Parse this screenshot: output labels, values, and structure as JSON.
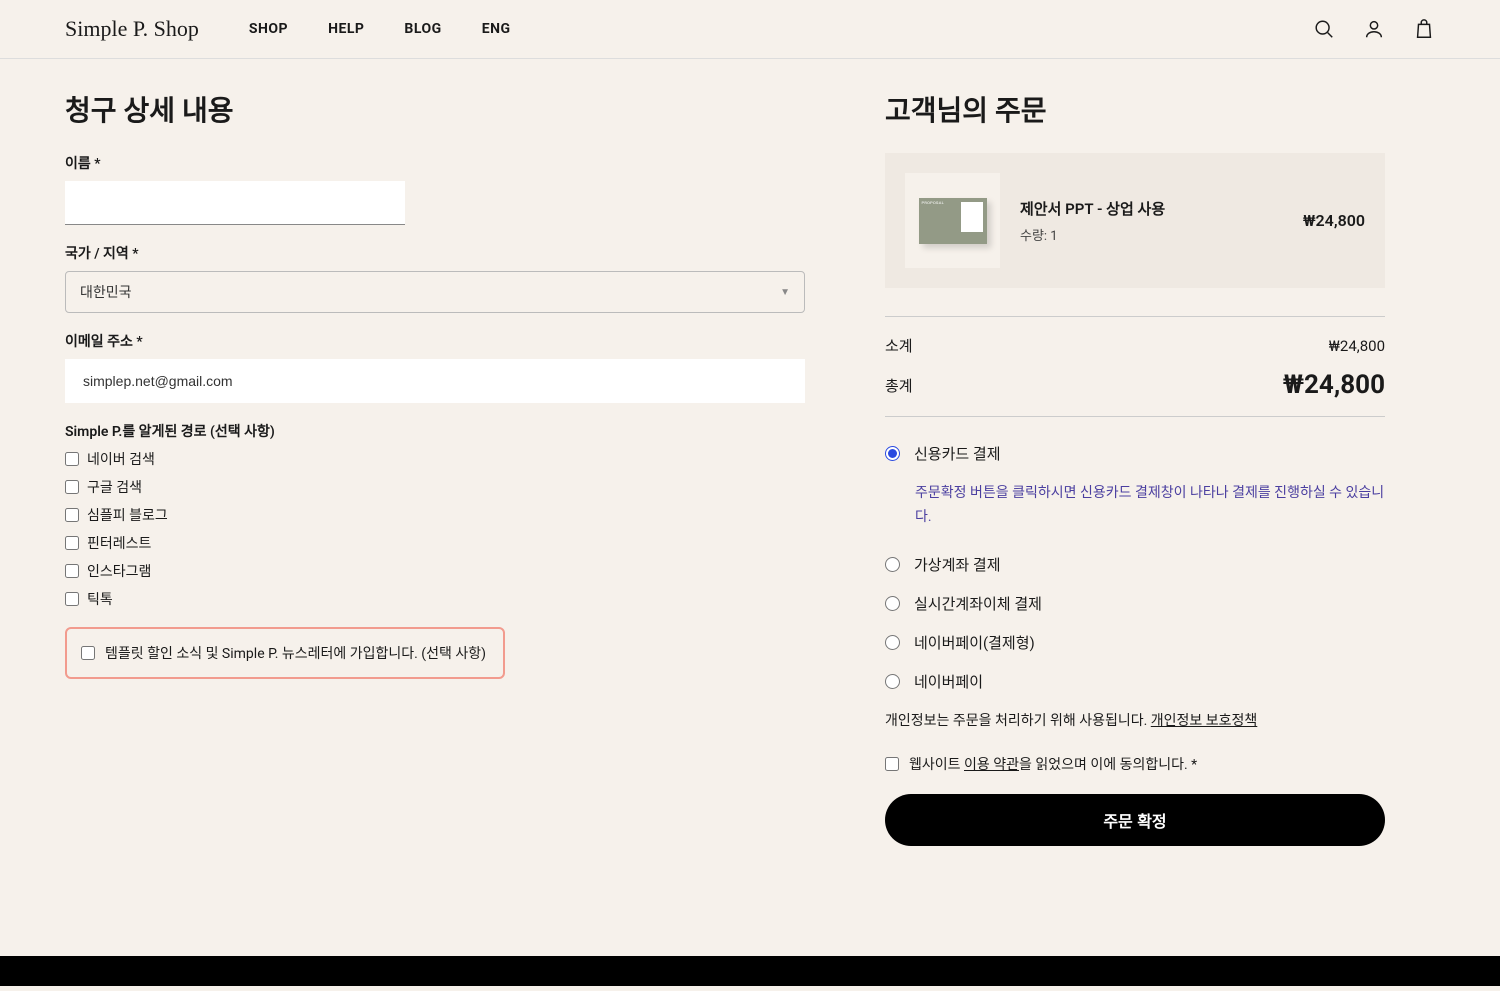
{
  "header": {
    "logo": "Simple P. Shop",
    "nav": [
      "SHOP",
      "HELP",
      "BLOG",
      "ENG"
    ]
  },
  "billing": {
    "title": "청구 상세 내용",
    "name_label": "이름 *",
    "name_value": "",
    "country_label": "국가 / 지역 *",
    "country_value": "대한민국",
    "email_label": "이메일 주소 *",
    "email_value": "simplep.net@gmail.com",
    "source_label": "Simple P.를 알게된 경로 (선택 사항)",
    "source_options": [
      "네이버 검색",
      "구글 검색",
      "심플피 블로그",
      "핀터레스트",
      "인스타그램",
      "틱톡"
    ],
    "newsletter_label": "템플릿 할인 소식 및 Simple P. 뉴스레터에 가입합니다. (선택 사항)"
  },
  "order": {
    "title": "고객님의 주문",
    "item": {
      "name": "제안서 PPT - 상업 사용",
      "qty_label": "수량: 1",
      "price": "₩24,800"
    },
    "subtotal_label": "소계",
    "subtotal_value": "₩24,800",
    "total_label": "총계",
    "total_value": "₩24,800"
  },
  "payment": {
    "methods": [
      "신용카드 결제",
      "가상계좌 결제",
      "실시간계좌이체 결제",
      "네이버페이(결제형)",
      "네이버페이"
    ],
    "selected_desc": "주문확정 버튼을 클릭하시면 신용카드 결제창이 나타나 결제를 진행하실 수 있습니다.",
    "privacy_text": "개인정보는 주문을 처리하기 위해 사용됩니다. ",
    "privacy_link": "개인정보 보호정책",
    "terms_prefix": "웹사이트 ",
    "terms_link": "이용 약관",
    "terms_suffix": "을 읽었으며 이에 동의합니다. *",
    "confirm_label": "주문 확정"
  }
}
